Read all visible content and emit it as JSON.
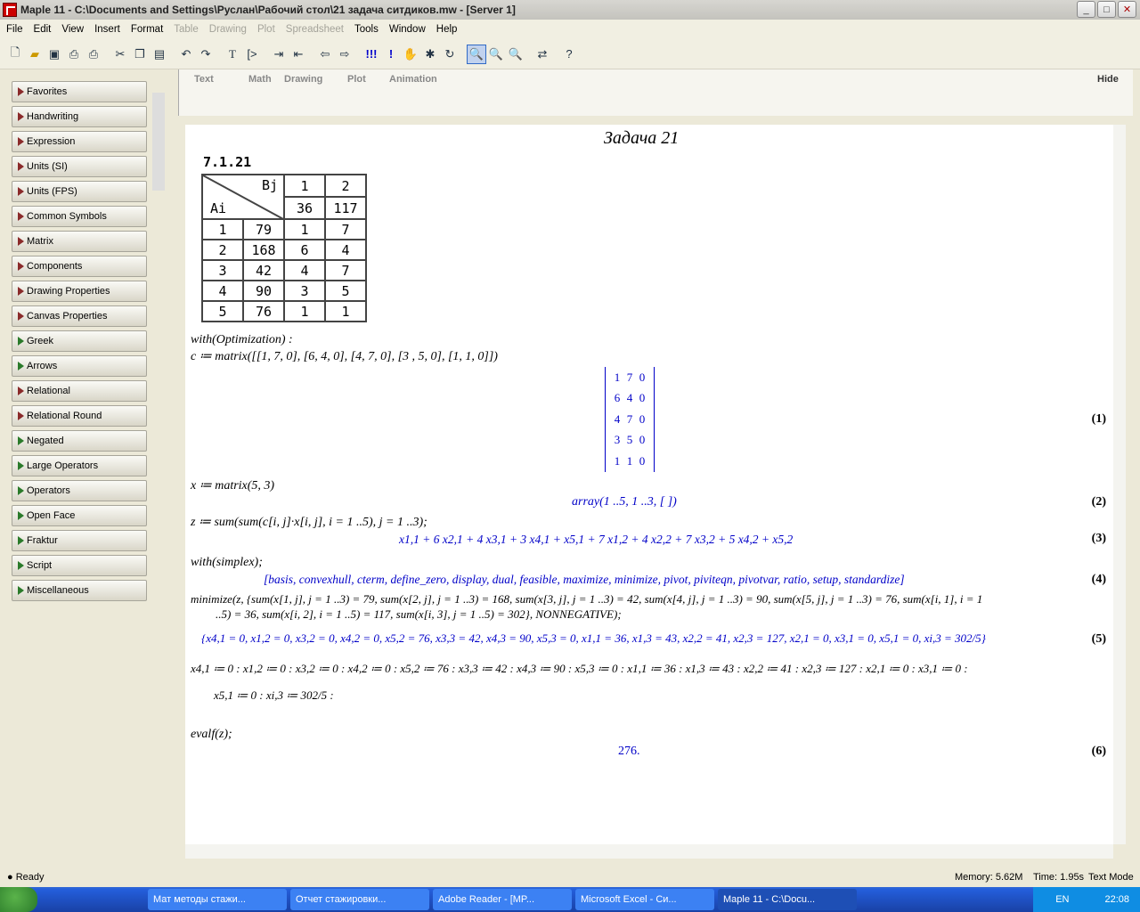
{
  "window": {
    "title": "Maple 11 - C:\\Documents and Settings\\Руслан\\Рабочий стол\\21 задача ситдиков.mw - [Server 1]",
    "buttons": [
      "_",
      "□",
      "✕"
    ]
  },
  "menu": [
    {
      "label": "File",
      "enabled": true
    },
    {
      "label": "Edit",
      "enabled": true
    },
    {
      "label": "View",
      "enabled": true
    },
    {
      "label": "Insert",
      "enabled": true
    },
    {
      "label": "Format",
      "enabled": true
    },
    {
      "label": "Table",
      "enabled": false
    },
    {
      "label": "Drawing",
      "enabled": false
    },
    {
      "label": "Plot",
      "enabled": false
    },
    {
      "label": "Spreadsheet",
      "enabled": false
    },
    {
      "label": "Tools",
      "enabled": true
    },
    {
      "label": "Window",
      "enabled": true
    },
    {
      "label": "Help",
      "enabled": true
    }
  ],
  "toolbar_icons": [
    "new-icon",
    "open-icon",
    "save-icon",
    "print-icon",
    "print-preview-icon",
    "cut-icon",
    "copy-icon",
    "paste-icon",
    "undo-icon",
    "redo-icon",
    "text-icon",
    "prompt-icon",
    "indent-icon",
    "outdent-icon",
    "back-icon",
    "forward-icon",
    "execute-all-icon",
    "execute-icon",
    "stop-icon",
    "debug-icon",
    "restart-icon",
    "zoom-100-icon",
    "zoom-150-icon",
    "zoom-200-icon",
    "toggle-icon",
    "help-icon"
  ],
  "palettes": [
    {
      "label": "Favorites",
      "color": "red"
    },
    {
      "label": "Handwriting",
      "color": "red"
    },
    {
      "label": "Expression",
      "color": "red"
    },
    {
      "label": "Units (SI)",
      "color": "red"
    },
    {
      "label": "Units (FPS)",
      "color": "red"
    },
    {
      "label": "Common Symbols",
      "color": "red"
    },
    {
      "label": "Matrix",
      "color": "red"
    },
    {
      "label": "Components",
      "color": "red"
    },
    {
      "label": "Drawing Properties",
      "color": "red"
    },
    {
      "label": "Canvas Properties",
      "color": "red"
    },
    {
      "label": "Greek",
      "color": "green"
    },
    {
      "label": "Arrows",
      "color": "green"
    },
    {
      "label": "Relational",
      "color": "red"
    },
    {
      "label": "Relational Round",
      "color": "red"
    },
    {
      "label": "Negated",
      "color": "green"
    },
    {
      "label": "Large Operators",
      "color": "green"
    },
    {
      "label": "Operators",
      "color": "green"
    },
    {
      "label": "Open Face",
      "color": "green"
    },
    {
      "label": "Fraktur",
      "color": "green"
    },
    {
      "label": "Script",
      "color": "green"
    },
    {
      "label": "Miscellaneous",
      "color": "green"
    }
  ],
  "context_tabs": [
    "Text",
    "Math",
    "Drawing",
    "Plot",
    "Animation"
  ],
  "context_hide": "Hide",
  "doc": {
    "heading": "Задача 21",
    "table_caption": "7.1.21",
    "table": {
      "header_b": "Bj",
      "header_a": "Ai",
      "b_index": [
        "1",
        "2"
      ],
      "b_values": [
        "36",
        "117"
      ],
      "rows": [
        [
          "1",
          "79",
          "1",
          "7"
        ],
        [
          "2",
          "168",
          "6",
          "4"
        ],
        [
          "3",
          "42",
          "4",
          "7"
        ],
        [
          "4",
          "90",
          "3",
          "5"
        ],
        [
          "5",
          "76",
          "1",
          "1"
        ]
      ]
    },
    "lines": [
      "with(Optimization) :",
      "c ≔ matrix([[1, 7, 0], [6, 4, 0], [4, 7, 0], [3 , 5, 0], [1, 1, 0]])",
      "x ≔ matrix(5, 3)",
      "z ≔ sum(sum(c[i, j]·x[i, j], i = 1 ..5), j = 1 ..3);",
      "with(simplex);",
      "minimize(z, {sum(x[1, j], j = 1 ..3) = 79, sum(x[2, j], j = 1 ..3) = 168, sum(x[3, j], j = 1 ..3) = 42, sum(x[4, j], j = 1 ..3) = 90, sum(x[5, j], j = 1 ..3) = 76, sum(x[i, 1], i = 1",
      "..5) = 36, sum(x[i, 2], i = 1 ..5) = 117, sum(x[i, 3], j = 1 ..5) = 302}, NONNEGATIVE);",
      "evalf(z);"
    ],
    "matrix_rows": [
      [
        "1",
        "7",
        "0"
      ],
      [
        "6",
        "4",
        "0"
      ],
      [
        "4",
        "7",
        "0"
      ],
      [
        "3",
        "5",
        "0"
      ],
      [
        "1",
        "1",
        "0"
      ]
    ],
    "out2": "array(1 ..5, 1 ..3, [ ])",
    "out3": "x1,1 + 6 x2,1 + 4 x3,1 + 3 x4,1 + x5,1 + 7 x1,2 + 4 x2,2 + 7 x3,2 + 5 x4,2 + x5,2",
    "out4": "[basis, convexhull, cterm, define_zero, display, dual, feasible, maximize, minimize, pivot, piviteqn, pivotvar, ratio, setup, standardize]",
    "out5": "{x4,1 = 0, x1,2 = 0, x3,2 = 0, x4,2 = 0, x5,2 = 76, x3,3 = 42, x4,3 = 90, x5,3 = 0, x1,1 = 36, x1,3 = 43, x2,2 = 41, x2,3 = 127, x2,1 = 0, x3,1 = 0, x5,1 = 0, xi,3 = 302/5}",
    "assign1": "x4,1 ≔ 0 : x1,2 ≔ 0 : x3,2 ≔ 0 : x4,2 ≔ 0 : x5,2 ≔ 76 : x3,3 ≔ 42 : x4,3 ≔ 90 : x5,3 ≔ 0 : x1,1 ≔ 36 : x1,3 ≔ 43 : x2,2 ≔ 41 : x2,3 ≔ 127 : x2,1 ≔ 0 : x3,1 ≔ 0 :",
    "assign2": "x5,1 ≔ 0 : xi,3 ≔ 302/5 :",
    "out6": "276.",
    "labels": [
      "(1)",
      "(2)",
      "(3)",
      "(4)",
      "(5)",
      "(6)"
    ]
  },
  "status": {
    "ready": "Ready",
    "memory": "Memory: 5.62M",
    "time": "Time: 1.95s",
    "mode": "Text Mode"
  },
  "taskbar": {
    "tasks": [
      {
        "label": "Мат методы стажи...",
        "active": false
      },
      {
        "label": "Отчет стажировки...",
        "active": false
      },
      {
        "label": "Adobe Reader - [MP...",
        "active": false
      },
      {
        "label": "Microsoft Excel - Си...",
        "active": false
      },
      {
        "label": "Maple 11 - C:\\Docu...",
        "active": true
      }
    ],
    "lang": "EN",
    "clock": "22:08"
  }
}
